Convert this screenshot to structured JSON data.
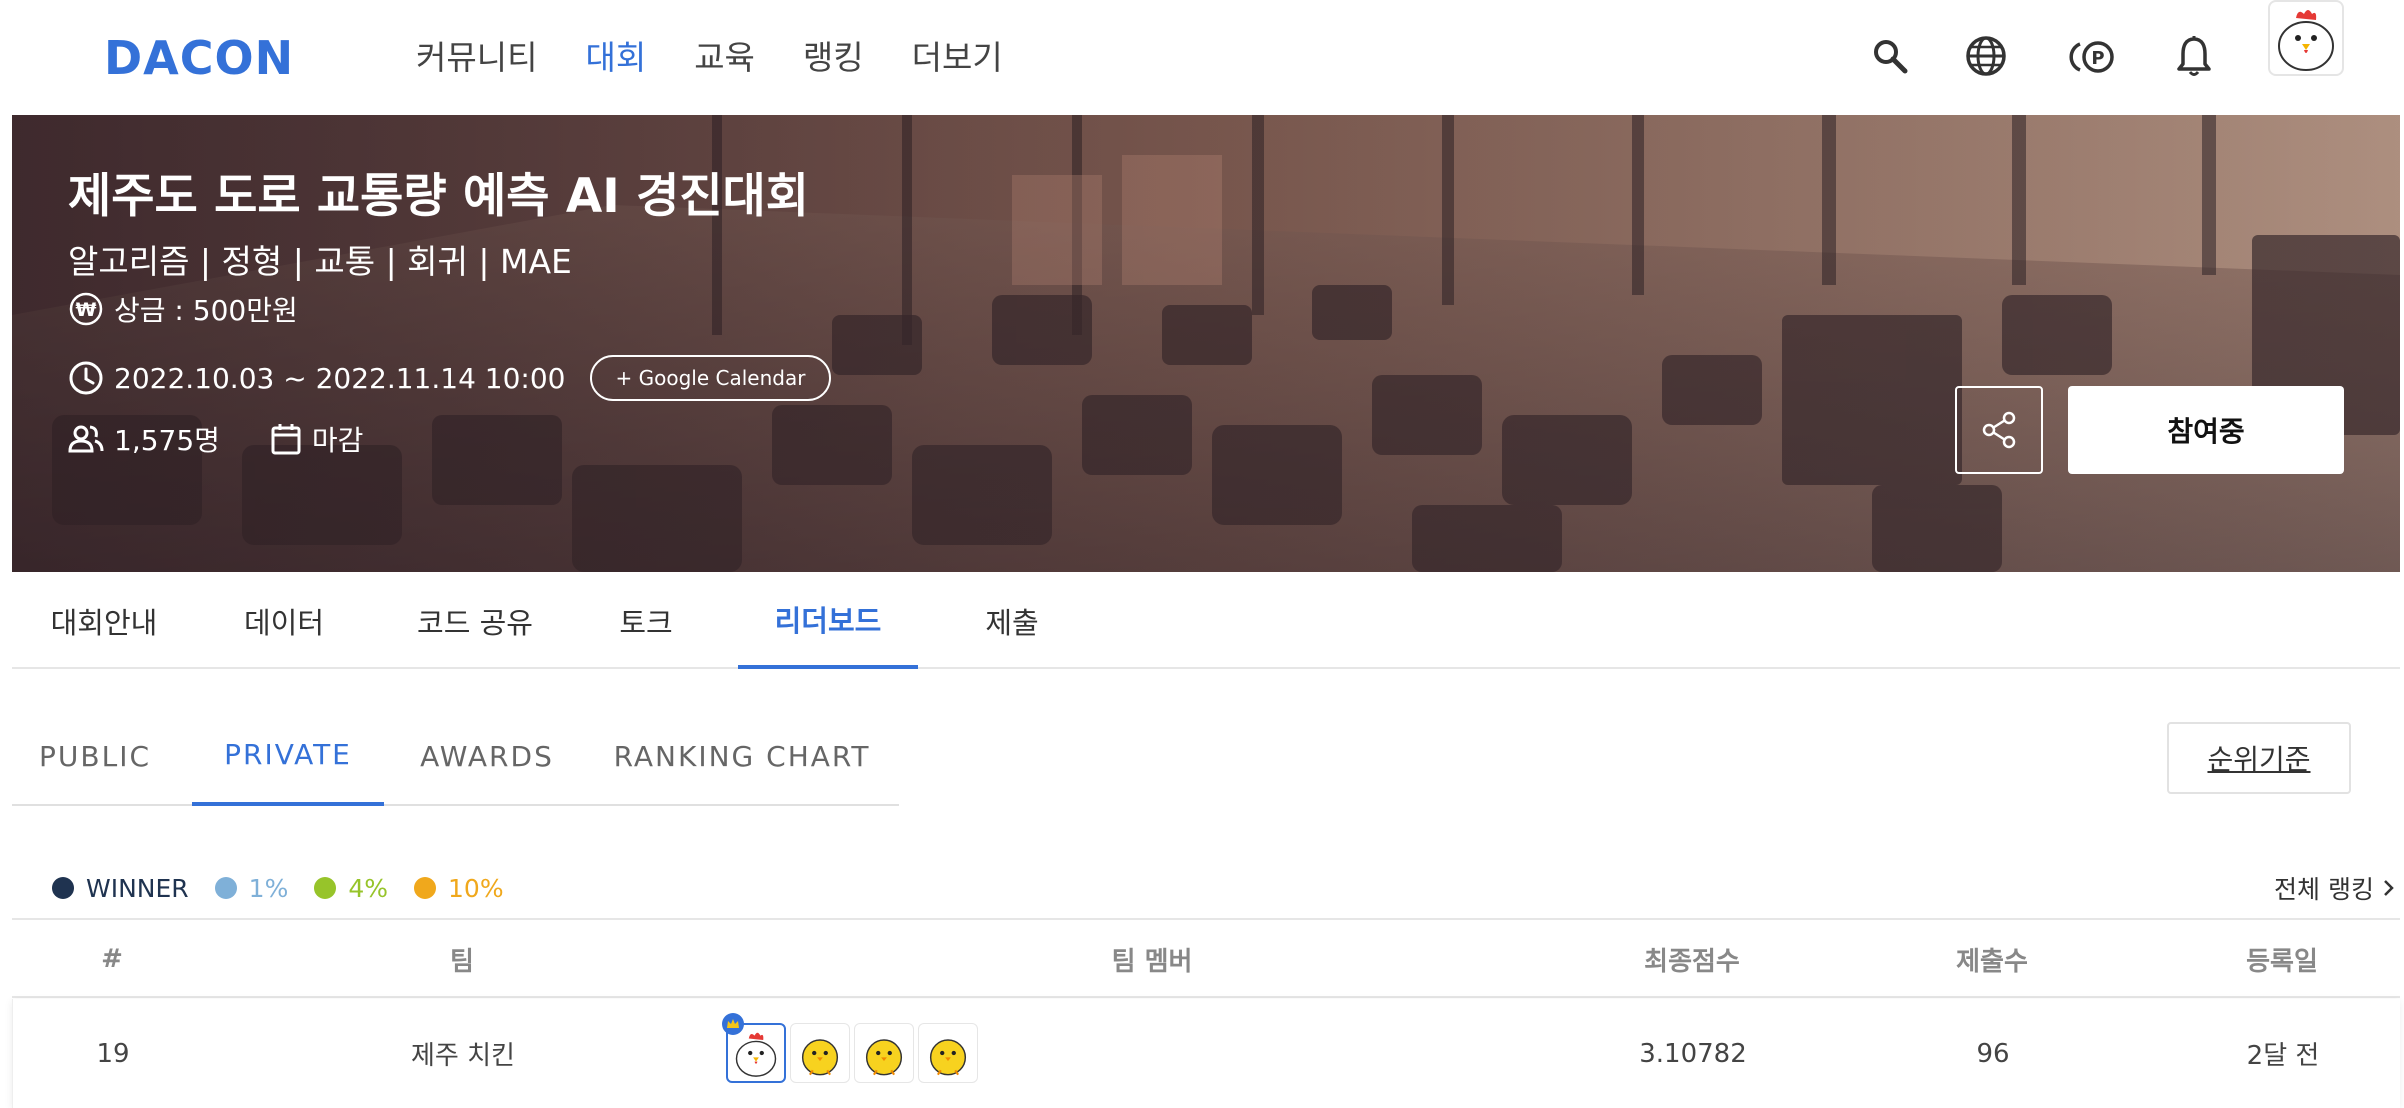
{
  "nav": {
    "logo": "DACON",
    "items": [
      {
        "label": "커뮤니티",
        "active": false
      },
      {
        "label": "대회",
        "active": true
      },
      {
        "label": "교육",
        "active": false
      },
      {
        "label": "랭킹",
        "active": false
      },
      {
        "label": "더보기",
        "active": false
      }
    ],
    "icons": [
      "search-icon",
      "globe-icon",
      "point-icon",
      "bell-icon"
    ],
    "accent_color": "#3471d8"
  },
  "hero": {
    "title": "제주도 도로 교통량 예측 AI 경진대회",
    "tags": "알고리즘 | 정형 | 교통 | 회귀 | MAE",
    "prize": "상금 : 500만원",
    "period": "2022.10.03 ~ 2022.11.14 10:00",
    "calendar_button": "+ Google Calendar",
    "participants": "1,575명",
    "status": "마감",
    "join_button": "참여중"
  },
  "main_tabs": [
    {
      "label": "대회안내",
      "active": false
    },
    {
      "label": "데이터",
      "active": false
    },
    {
      "label": "코드 공유",
      "active": false
    },
    {
      "label": "토크",
      "active": false
    },
    {
      "label": "리더보드",
      "active": true
    },
    {
      "label": "제출",
      "active": false
    }
  ],
  "sub_tabs": [
    {
      "label": "PUBLIC",
      "active": false
    },
    {
      "label": "PRIVATE",
      "active": true
    },
    {
      "label": "AWARDS",
      "active": false
    },
    {
      "label": "RANKING CHART",
      "active": false
    }
  ],
  "rank_criteria_button": "순위기준",
  "legend": [
    {
      "label": "WINNER",
      "color": "#1f3350"
    },
    {
      "label": "1%",
      "color": "#7fb0d8"
    },
    {
      "label": "4%",
      "color": "#97c42a"
    },
    {
      "label": "10%",
      "color": "#f0a81c"
    }
  ],
  "full_ranking_link": "전체 랭킹",
  "table": {
    "headers": {
      "rank": "#",
      "team": "팀",
      "members": "팀 멤버",
      "score": "최종점수",
      "submissions": "제출수",
      "date": "등록일"
    },
    "rows": [
      {
        "rank": "19",
        "team": "제주 치킨",
        "members": [
          "chicken-avatar",
          "chick-avatar",
          "chick-avatar",
          "chick-avatar"
        ],
        "score": "3.10782",
        "submissions": "96",
        "date": "2달 전"
      }
    ]
  }
}
